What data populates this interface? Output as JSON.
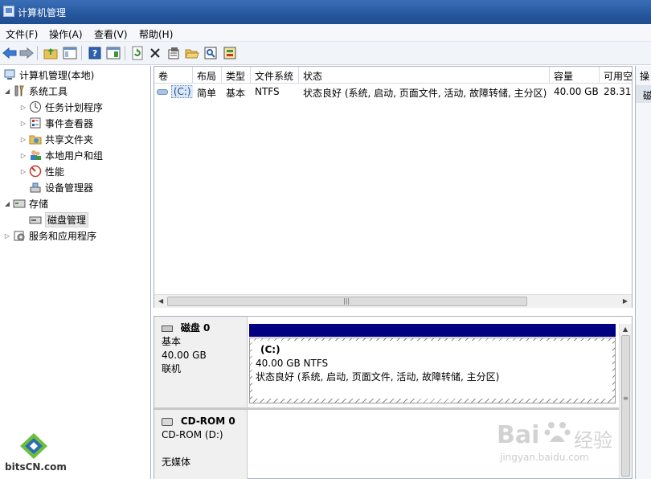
{
  "window": {
    "title": "计算机管理"
  },
  "menu": [
    "文件(F)",
    "操作(A)",
    "查看(V)",
    "帮助(H)"
  ],
  "tree": {
    "root": "计算机管理(本地)",
    "system_tools": "系统工具",
    "task_scheduler": "任务计划程序",
    "event_viewer": "事件查看器",
    "shared_folders": "共享文件夹",
    "local_users": "本地用户和组",
    "performance": "性能",
    "device_manager": "设备管理器",
    "storage": "存储",
    "disk_management": "磁盘管理",
    "services_apps": "服务和应用程序"
  },
  "volume_table": {
    "headers": [
      "卷",
      "布局",
      "类型",
      "文件系统",
      "状态",
      "容量",
      "可用空"
    ],
    "row": {
      "volume": "(C:)",
      "layout": "简单",
      "type": "基本",
      "fs": "NTFS",
      "status": "状态良好 (系统, 启动, 页面文件, 活动, 故障转储, 主分区)",
      "capacity": "40.00 GB",
      "free": "28.31"
    }
  },
  "actions_pane": {
    "header": "操",
    "item": "磁"
  },
  "disk0": {
    "name": "磁盘 0",
    "kind": "基本",
    "size": "40.00 GB",
    "state": "联机",
    "partition": {
      "label": "(C:)",
      "size_fs": "40.00 GB NTFS",
      "status": "状态良好 (系统, 启动, 页面文件, 活动, 故障转储, 主分区)"
    }
  },
  "cdrom": {
    "name": "CD-ROM 0",
    "drive": "CD-ROM (D:)",
    "media": "无媒体"
  },
  "watermarks": {
    "site": "bitsCN.com",
    "baidu_brand": "Bai",
    "baidu_suffix": "经验",
    "baidu_url": "jingyan.baidu.com"
  },
  "colors": {
    "titlebar": "#26579e",
    "disk_bar": "#000080"
  }
}
